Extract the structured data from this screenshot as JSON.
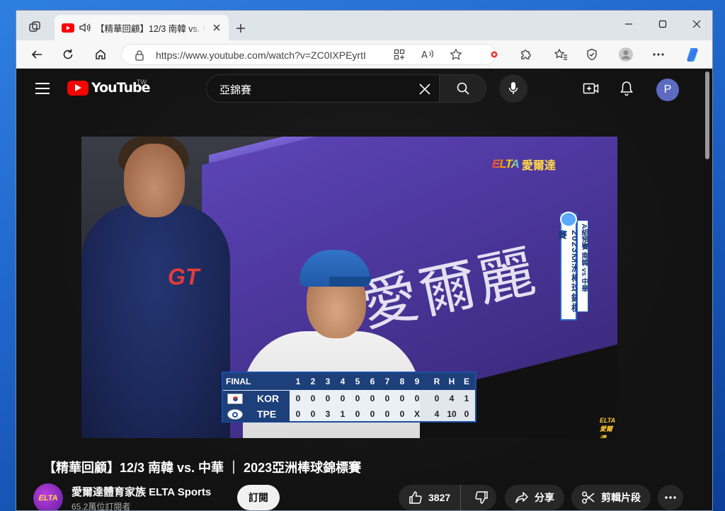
{
  "browser": {
    "tab": {
      "title": "【精華回顧】12/3 南韓 vs. 中華"
    },
    "address": {
      "url": "https://www.youtube.com/watch?v=ZC0IXPEyrtI"
    },
    "colors": {
      "accent": "#1e63c7",
      "tab_bg": "#f7f7f7",
      "strip_bg": "#dfe3ea"
    }
  },
  "youtube": {
    "logo_text": "YouTube",
    "region": "TW",
    "search_value": "亞錦賽",
    "avatar_initial": "P",
    "video_overlay": {
      "wall_text": "愛爾麗",
      "broadcaster_word": "ELTA",
      "broadcaster_cn": "愛爾達",
      "side_banner": "2023亞洲棒球錦標賽",
      "side_tag": "A組預賽 南韓 vs 中華",
      "corner_mark": "ELTA 愛爾達",
      "jersey_logo": "GT"
    },
    "scoreboard": {
      "status": "FINAL",
      "innings": [
        "1",
        "2",
        "3",
        "4",
        "5",
        "6",
        "7",
        "8",
        "9"
      ],
      "rhe_headers": [
        "R",
        "H",
        "E"
      ],
      "teams": [
        {
          "code": "KOR",
          "innings": [
            "0",
            "0",
            "0",
            "0",
            "0",
            "0",
            "0",
            "0",
            "0"
          ],
          "rhe": [
            "0",
            "4",
            "1"
          ]
        },
        {
          "code": "TPE",
          "innings": [
            "0",
            "0",
            "3",
            "1",
            "0",
            "0",
            "0",
            "0",
            "X"
          ],
          "rhe": [
            "4",
            "10",
            "0"
          ]
        }
      ]
    },
    "video": {
      "title": "【精華回顧】12/3 南韓 vs. 中華 ｜ 2023亞洲棒球錦標賽",
      "channel_name": "愛爾達體育家族 ELTA Sports",
      "channel_avatar_text": "ELTA",
      "subscribers": "65.2萬位訂閱者",
      "subscribe_label": "訂閱",
      "like_count": "3827",
      "share_label": "分享",
      "clip_label": "剪輯片段"
    }
  }
}
